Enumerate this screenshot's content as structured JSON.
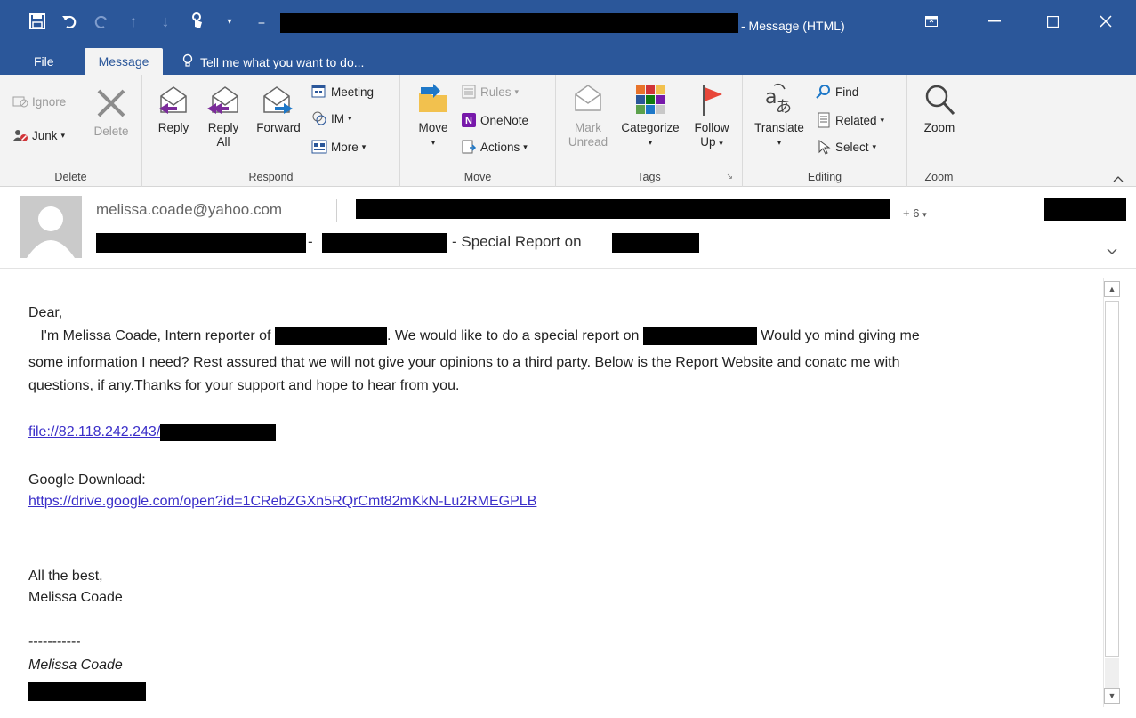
{
  "window": {
    "title_suffix": "- Message (HTML)",
    "controls": [
      "ribbon-display-icon",
      "minimize-icon",
      "maximize-icon",
      "close-icon"
    ]
  },
  "qat": {
    "icons": [
      "save-icon",
      "undo-icon",
      "redo-icon",
      "up-icon",
      "down-icon",
      "touch-mode-icon",
      "customize-icon"
    ]
  },
  "tabs": {
    "file": "File",
    "message": "Message",
    "tell_me": "Tell me what you want to do..."
  },
  "ribbon": {
    "delete": {
      "label": "Delete",
      "ignore": "Ignore",
      "junk": "Junk",
      "delete_btn": "Delete"
    },
    "respond": {
      "label": "Respond",
      "reply": "Reply",
      "reply_all_1": "Reply",
      "reply_all_2": "All",
      "forward": "Forward",
      "meeting": "Meeting",
      "im": "IM",
      "more": "More"
    },
    "move": {
      "label": "Move",
      "move_btn": "Move",
      "rules": "Rules",
      "onenote": "OneNote",
      "actions": "Actions"
    },
    "tags": {
      "label": "Tags",
      "mark_unread_1": "Mark",
      "mark_unread_2": "Unread",
      "categorize": "Categorize",
      "follow_up_1": "Follow",
      "follow_up_2": "Up"
    },
    "editing": {
      "label": "Editing",
      "translate": "Translate",
      "find": "Find",
      "related": "Related",
      "select": "Select"
    },
    "zoom": {
      "label": "Zoom",
      "zoom_btn": "Zoom"
    }
  },
  "header": {
    "sender": "melissa.coade@yahoo.com",
    "more_recipients": "+ 6",
    "subject_dash": "-",
    "subject_text": "- Special Report on"
  },
  "body": {
    "greeting": "Dear,",
    "p1_a": "   I'm Melissa Coade, Intern reporter of",
    "p1_b": ". We would like to do a special report on",
    "p1_c": " Would yo mind giving me",
    "p2": "some information I need? Rest assured that we will not give your opinions to a third party. Below is the Report Website and conatc me with",
    "p3": "questions, if any.Thanks for your support and hope to hear from you.",
    "link1": "file://82.118.242.243/",
    "google_label": "Google Download:",
    "link2": "https://drive.google.com/open?id=1CRebZGXn5RQrCmt82mKkN-Lu2RMEGPLB",
    "closing": "All the best,",
    "sig_name": "Melissa Coade",
    "dashes": "-----------",
    "sig_italic": "Melissa Coade"
  },
  "colors": {
    "accent": "#2b579a",
    "link": "#3b2fc9",
    "ribbon_bg": "#f3f3f3"
  }
}
